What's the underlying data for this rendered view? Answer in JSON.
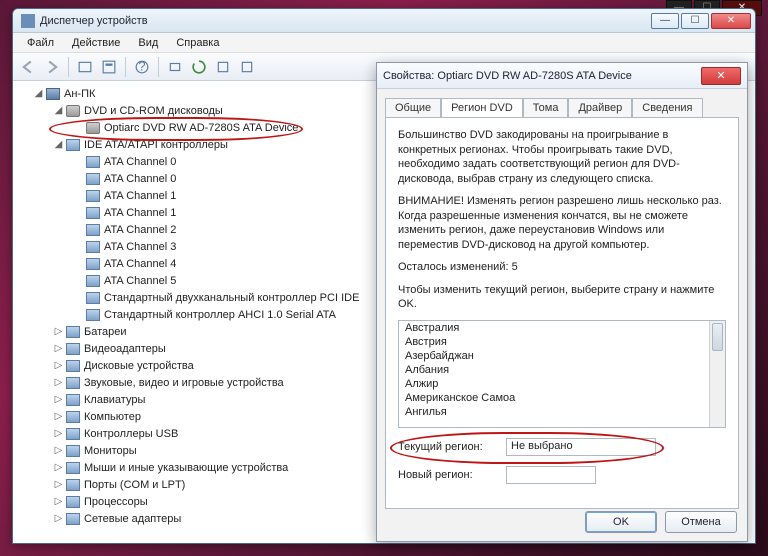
{
  "bgwin": {
    "min": "—",
    "max": "☐",
    "close": "✕"
  },
  "dm": {
    "title": "Диспетчер устройств",
    "winbtns": {
      "min": "—",
      "max": "☐",
      "close": "✕"
    },
    "menu": {
      "file": "Файл",
      "action": "Действие",
      "view": "Вид",
      "help": "Справка"
    },
    "tree": {
      "root": "Ан-ПК",
      "dvd_cat": "DVD и CD-ROM дисководы",
      "dvd_dev": "Optiarc DVD RW AD-7280S ATA Device",
      "ide_cat": "IDE ATA/ATAPI контроллеры",
      "ide": [
        "ATA Channel 0",
        "ATA Channel 0",
        "ATA Channel 1",
        "ATA Channel 1",
        "ATA Channel 2",
        "ATA Channel 3",
        "ATA Channel 4",
        "ATA Channel 5",
        "Стандартный двухканальный контроллер PCI IDE",
        "Стандартный контроллер AHCI 1.0 Serial ATA"
      ],
      "rest": [
        "Батареи",
        "Видеоадаптеры",
        "Дисковые устройства",
        "Звуковые, видео и игровые устройства",
        "Клавиатуры",
        "Компьютер",
        "Контроллеры USB",
        "Мониторы",
        "Мыши и иные указывающие устройства",
        "Порты (COM и LPT)",
        "Процессоры",
        "Сетевые адаптеры"
      ]
    }
  },
  "props": {
    "title": "Свойства: Optiarc DVD RW AD-7280S ATA Device",
    "close": "✕",
    "tabs": {
      "general": "Общие",
      "region": "Регион DVD",
      "volumes": "Тома",
      "driver": "Драйвер",
      "details": "Сведения"
    },
    "body": {
      "p1": "Большинство DVD закодированы на проигрывание в конкретных регионах. Чтобы проигрывать такие DVD, необходимо задать соответствующий регион для DVD-дисковода, выбрав страну из следующего списка.",
      "p2": "ВНИМАНИЕ! Изменять регион разрешено лишь несколько раз. Когда разрешенные изменения кончатся, вы не сможете изменить регион, даже переустановив Windows или переместив DVD-дисковод на другой компьютер.",
      "remaining": "Осталось изменений: 5",
      "instruct": "Чтобы изменить текущий регион, выберите страну и нажмите OK.",
      "regions": [
        "Австралия",
        "Австрия",
        "Азербайджан",
        "Албания",
        "Алжир",
        "Американское Самоа",
        "Ангилья"
      ],
      "cur_label": "Текущий регион:",
      "cur_value": "Не выбрано",
      "new_label": "Новый регион:",
      "new_value": ""
    },
    "buttons": {
      "ok": "OK",
      "cancel": "Отмена"
    }
  }
}
